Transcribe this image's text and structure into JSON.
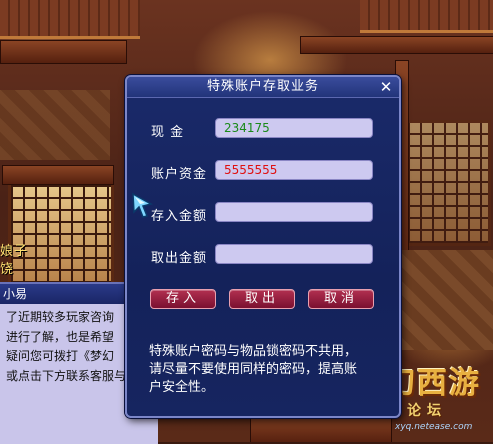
{
  "background": {
    "npc_name_line1": "娘子",
    "npc_name_line2": "饶"
  },
  "side_dialog": {
    "title": "小易",
    "lines": [
      "了近期较多玩家咨询",
      "进行了解，也是希望",
      "疑问您可拨打《梦幻",
      "或点击下方联系客服与我"
    ]
  },
  "modal": {
    "title": "特殊账户存取业务",
    "close_symbol": "✕",
    "rows": [
      {
        "label": "现    金",
        "value": "234175",
        "color": "#1a8a1a"
      },
      {
        "label": "账户资金",
        "value": "5555555",
        "color": "#e01010"
      },
      {
        "label": "存入金额",
        "value": ""
      },
      {
        "label": "取出金额",
        "value": ""
      }
    ],
    "buttons": {
      "deposit": "存入",
      "withdraw": "取出",
      "cancel": "取消"
    },
    "notice_lines": [
      "特殊账户密码与物品锁密码不共用，",
      "请尽量不要使用同样的密码，提高账",
      "户安全性。"
    ]
  },
  "logo": {
    "main": "梦幻西游",
    "sub": "官方论坛",
    "url": "xyq.netease.com"
  },
  "colors": {
    "modal_bg": "#1a2a6a",
    "field_bg": "#cdc9f0",
    "button_bg": "#9a2040",
    "cash_text": "#1a8a1a",
    "account_text": "#e01010"
  }
}
